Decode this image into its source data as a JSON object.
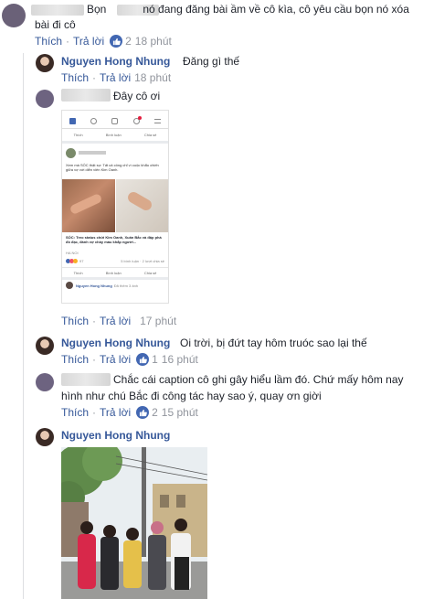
{
  "comments": [
    {
      "text": "Bọn        nó đang đăng bài ầm về cô kìa, cô yêu cầu bọn nó xóa bài đi cô",
      "like_label": "Thích",
      "reply_label": "Trả lời",
      "likes": "2",
      "time": "18 phút"
    }
  ],
  "replies": [
    {
      "author": "Nguyen Hong Nhung",
      "text": "Đăng gì thế",
      "like_label": "Thích",
      "reply_label": "Trả lời",
      "time": "18 phút"
    },
    {
      "text": "Đây cô ơi",
      "like_label": "Thích",
      "reply_label": "Trả lời",
      "time": "17 phút",
      "screenshot": {
        "post_text": "Xem mà SỐC thật sự: Tất cả công chỉ vì cuộc khẩu chiến giữa vợ với diễn viên Kim Oanh.",
        "headline": "SỐC: Treo status chửi Kim Oanh, Xuân Bắc và đập phá đồ đạc, đánh vợ chảy máu khắp người...",
        "source": "HA NOI",
        "reactions": "97",
        "stats": "5 bình luận · 2 lượt chia sẻ",
        "btn_like": "Thích",
        "btn_comment": "Bình luận",
        "btn_share": "Chia sẻ",
        "footer_name": "Nguyen Hong Nhung",
        "footer_text": "Đã thêm 3 ảnh"
      }
    },
    {
      "author": "Nguyen Hong Nhung",
      "text": "Oi trời, bị đứt tay hôm truóc sao lại thế",
      "like_label": "Thích",
      "reply_label": "Trả lời",
      "likes": "1",
      "time": "16 phút"
    },
    {
      "text_line1": "Chắc cái caption cô ghi gây hiểu lầm đó. Chứ mấy hôm nay",
      "text_line2": "hình như chú Bắc đi công tác hay sao ý, quay ơn giời",
      "like_label": "Thích",
      "reply_label": "Trả lời",
      "likes": "2",
      "time": "15 phút"
    },
    {
      "author": "Nguyen Hong Nhung"
    }
  ],
  "colors": {
    "link": "#365899",
    "meta": "#90949c",
    "like_badge": "#4267b2",
    "fb_blue": "#4267b2"
  }
}
